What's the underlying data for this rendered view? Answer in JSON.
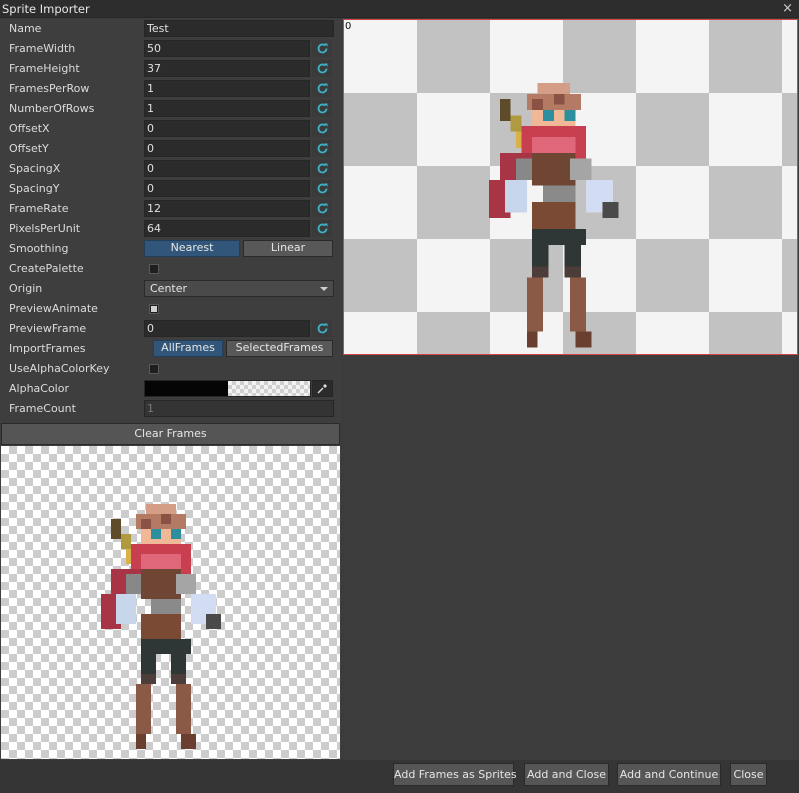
{
  "window": {
    "title": "Sprite Importer",
    "close_glyph": "×"
  },
  "properties": {
    "name": {
      "label": "Name",
      "value": "Test"
    },
    "frame_width": {
      "label": "FrameWidth",
      "value": "50"
    },
    "frame_height": {
      "label": "FrameHeight",
      "value": "37"
    },
    "frames_per_row": {
      "label": "FramesPerRow",
      "value": "1"
    },
    "number_of_rows": {
      "label": "NumberOfRows",
      "value": "1"
    },
    "offset_x": {
      "label": "OffsetX",
      "value": "0"
    },
    "offset_y": {
      "label": "OffsetY",
      "value": "0"
    },
    "spacing_x": {
      "label": "SpacingX",
      "value": "0"
    },
    "spacing_y": {
      "label": "SpacingY",
      "value": "0"
    },
    "frame_rate": {
      "label": "FrameRate",
      "value": "12"
    },
    "pixels_per_unit": {
      "label": "PixelsPerUnit",
      "value": "64"
    },
    "smoothing": {
      "label": "Smoothing",
      "options": [
        "Nearest",
        "Linear"
      ],
      "selected": "Nearest"
    },
    "create_palette": {
      "label": "CreatePalette",
      "checked": false
    },
    "origin": {
      "label": "Origin",
      "value": "Center"
    },
    "preview_animate": {
      "label": "PreviewAnimate",
      "checked": true
    },
    "preview_frame": {
      "label": "PreviewFrame",
      "value": "0"
    },
    "import_frames": {
      "label": "ImportFrames",
      "options": [
        "AllFrames",
        "SelectedFrames"
      ],
      "selected": "AllFrames"
    },
    "use_alpha_color_key": {
      "label": "UseAlphaColorKey",
      "checked": false
    },
    "alpha_color": {
      "label": "AlphaColor",
      "color": "#000000"
    },
    "frame_count": {
      "label": "FrameCount",
      "value": "1"
    }
  },
  "clear_frames_label": "Clear Frames",
  "preview": {
    "frame_index": "0",
    "border_color": "#d34545"
  },
  "footer": {
    "add_frames_as_sprites": "Add Frames as Sprites",
    "add_and_close": "Add and Close",
    "add_and_continue": "Add and Continue",
    "close": "Close"
  },
  "icons": {
    "reset": "refresh-icon",
    "picker": "eyedropper-icon",
    "dropdown": "chevron-down-icon"
  },
  "colors": {
    "accent": "#325679",
    "reset_icon": "#3fb2c8"
  }
}
